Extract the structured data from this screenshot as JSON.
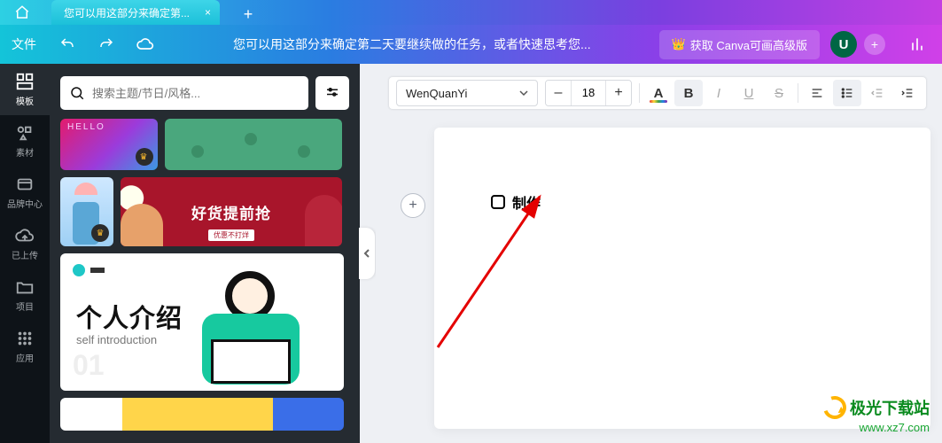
{
  "tabs": {
    "document_tab_title": "您可以用这部分来确定第...",
    "close_glyph": "×",
    "add_glyph": "+"
  },
  "header": {
    "file_label": "文件",
    "title_text": "您可以用这部分来确定第二天要继续做的任务，或者快速思考您...",
    "upgrade_crown": "👑",
    "upgrade_label": "获取 Canva可画高级版",
    "avatar_initial": "U",
    "plus_glyph": "+"
  },
  "side_nav": [
    {
      "key": "templates",
      "label": "模板",
      "active": true
    },
    {
      "key": "elements",
      "label": "素材",
      "active": false
    },
    {
      "key": "brand",
      "label": "品牌中心",
      "active": false
    },
    {
      "key": "uploads",
      "label": "已上传",
      "active": false
    },
    {
      "key": "projects",
      "label": "项目",
      "active": false
    },
    {
      "key": "apps",
      "label": "应用",
      "active": false
    }
  ],
  "panel": {
    "search_placeholder": "搜索主题/节日/风格...",
    "template_labels": {
      "hello": "HELLO",
      "red_banner_main": "好货提前抢",
      "red_banner_sub": "优惠不打烊",
      "intro_title": "个人介绍",
      "intro_sub": "self introduction",
      "intro_num": "01"
    }
  },
  "text_toolbar": {
    "font_name": "WenQuanYi",
    "size_value": "18",
    "minus": "–",
    "plus": "+",
    "color_letter": "A",
    "bold": "B",
    "italic": "I",
    "underline": "U",
    "strike": "S"
  },
  "canvas": {
    "add_glyph": "+",
    "checklist_text": "制作"
  },
  "watermark": {
    "brand_name": "极光下载站",
    "url": "www.xz7.com"
  }
}
